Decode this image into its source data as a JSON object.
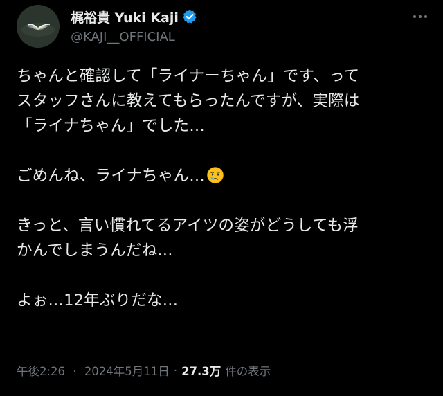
{
  "author": {
    "display_name": "梶裕貴 Yuki Kaji",
    "handle": "@KAJI__OFFICIAL",
    "verified": true,
    "verified_color": "#1d9bf0"
  },
  "tweet": {
    "lines": [
      "ちゃんと確認して「ライナーちゃん」です、って",
      "スタッフさんに教えてもらったんですが、実際は",
      "「ライナちゃん」でした…",
      "",
      "ごめんね、ライナちゃん…",
      "",
      "きっと、言い慣れてるアイツの姿がどうしても浮",
      "かんでしまうんだね…",
      "",
      "よぉ…12年ぶりだな…"
    ],
    "emoji_after_line_index": 4,
    "emoji_name": "crying-face"
  },
  "meta": {
    "time": "午後2:26",
    "separator": "·",
    "date": "2024年5月11日",
    "views_count": "27.3万",
    "views_label": "件の表示"
  },
  "colors": {
    "background": "#000000",
    "text": "#e7e9ea",
    "secondary": "#71767b"
  }
}
